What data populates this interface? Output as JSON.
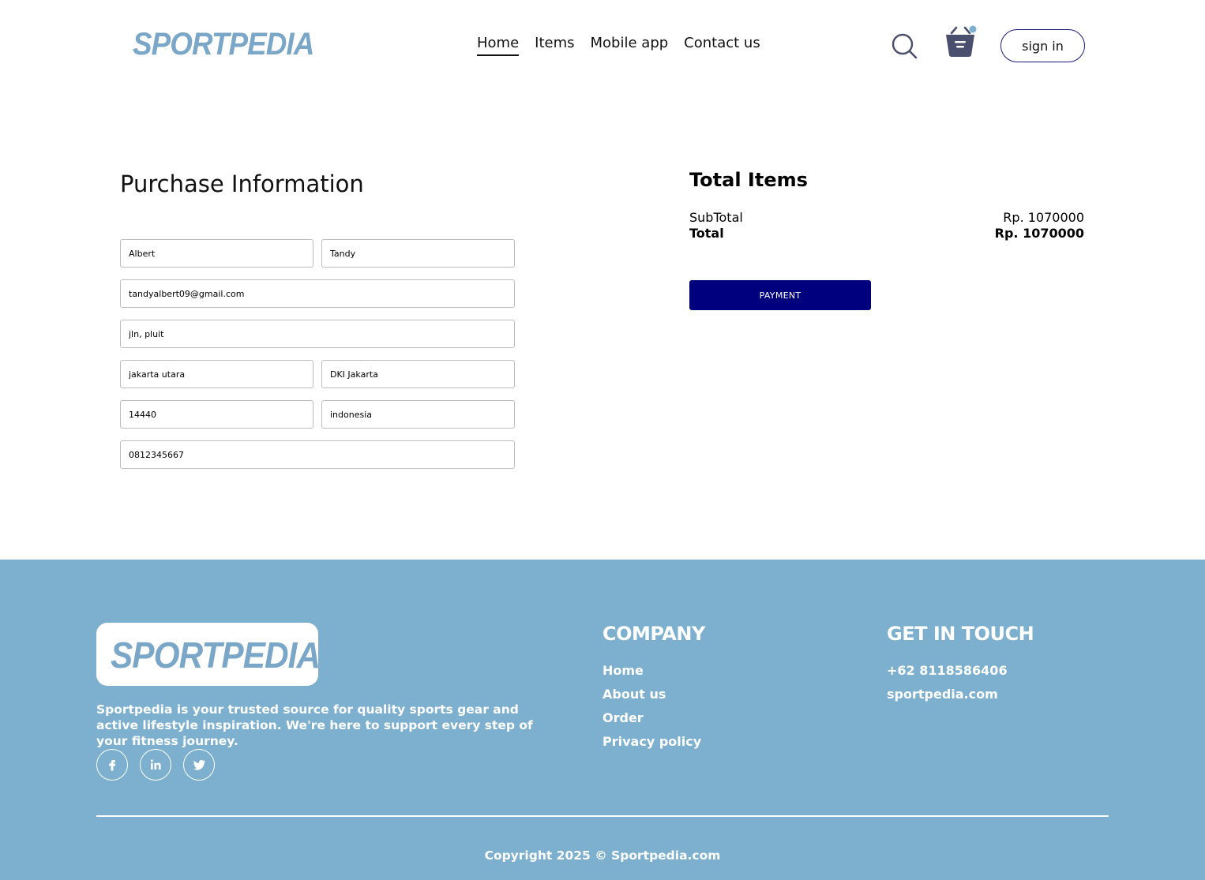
{
  "header": {
    "logo": "SPORTPEDIA",
    "nav": [
      {
        "label": "Home",
        "active": true
      },
      {
        "label": "Items",
        "active": false
      },
      {
        "label": "Mobile app",
        "active": false
      },
      {
        "label": "Contact us",
        "active": false
      }
    ],
    "sign_in_label": "sign in",
    "cart_badge_color": "#7cb0ce",
    "icons": [
      "search-icon",
      "cart-icon"
    ]
  },
  "purchase": {
    "title": "Purchase Information",
    "fields": {
      "first_name": "Albert",
      "last_name": "Tandy",
      "email": "tandyalbert09@gmail.com",
      "address": "jln, pluit",
      "city": "jakarta utara",
      "province": "DKI Jakarta",
      "postal_code": "14440",
      "country": "indonesia",
      "phone": "0812345667"
    }
  },
  "summary": {
    "title": "Total Items",
    "subtotal_label": "SubTotal",
    "subtotal_value": "Rp. 1070000",
    "total_label": "Total",
    "total_value": "Rp. 1070000",
    "payment_label": "PAYMENT",
    "payment_color": "#00007f"
  },
  "footer": {
    "logo": "SPORTPEDIA",
    "description": "Sportpedia is your trusted source for quality sports gear and active lifestyle inspiration. We're here to support every step of your fitness journey.",
    "socials": [
      "facebook-icon",
      "linkedin-icon",
      "twitter-icon"
    ],
    "company_title": "COMPANY",
    "company_links": [
      "Home",
      "About us",
      "Order",
      "Privacy policy"
    ],
    "contact_title": "GET IN TOUCH",
    "phone": "+62 8118586406",
    "website": "sportpedia.com",
    "copyright": "Copyright 2025 © Sportpedia.com",
    "background_color": "#7cb0ce"
  }
}
